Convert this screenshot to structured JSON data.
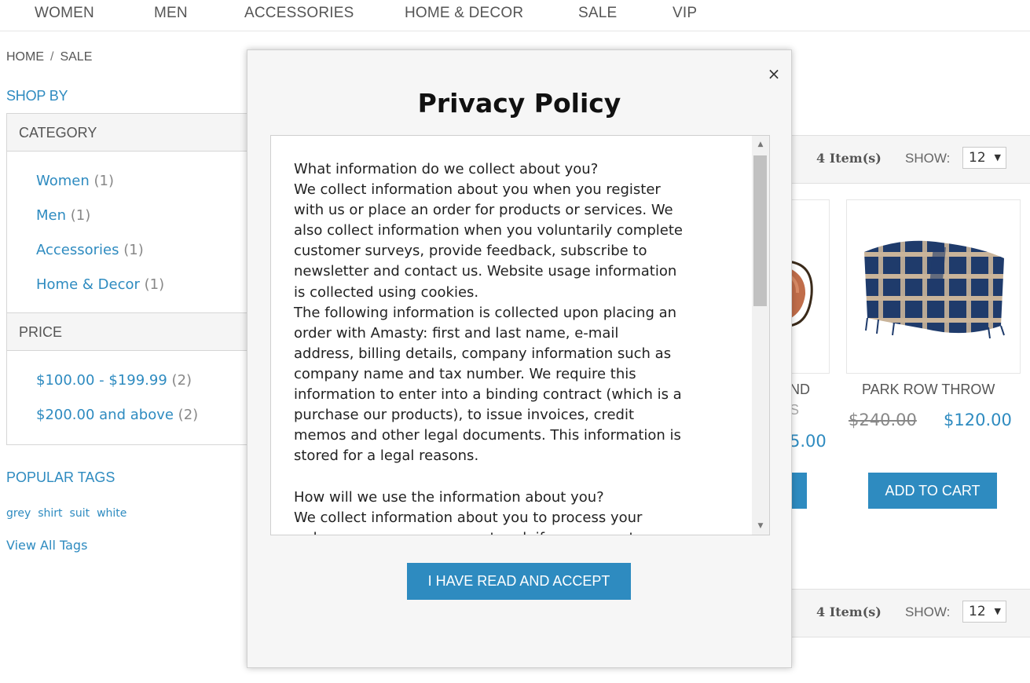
{
  "nav": [
    "WOMEN",
    "MEN",
    "ACCESSORIES",
    "HOME & DECOR",
    "SALE",
    "VIP"
  ],
  "breadcrumb": [
    "HOME",
    "SALE"
  ],
  "breadcrumb_sep": "/",
  "sidebar": {
    "shop_by": "SHOP BY",
    "category": {
      "title": "CATEGORY",
      "items": [
        {
          "label": "Women",
          "count": "(1)"
        },
        {
          "label": "Men",
          "count": "(1)"
        },
        {
          "label": "Accessories",
          "count": "(1)"
        },
        {
          "label": "Home & Decor",
          "count": "(1)"
        }
      ]
    },
    "price": {
      "title": "PRICE",
      "items": [
        {
          "label": "$100.00 - $199.99",
          "count": "(2)"
        },
        {
          "label": "$200.00 and above",
          "count": "(2)"
        }
      ]
    },
    "popular_tags": "POPULAR TAGS",
    "tags": [
      "grey",
      "shirt",
      "suit",
      "white"
    ],
    "view_all": "View All Tags"
  },
  "toolbar": {
    "count": "4 Item(s)",
    "show_label": "SHOW:",
    "show_value": "12",
    "arrow": "▼"
  },
  "products": [
    {
      "name_fragment": "ND",
      "name_fragment2": "S",
      "price_fragment": "5.00",
      "cart": ""
    },
    {
      "name": "PARK ROW THROW",
      "old_price": "$240.00",
      "new_price": "$120.00",
      "cart": "ADD TO CART"
    }
  ],
  "modal": {
    "close": "×",
    "title": "Privacy Policy",
    "body": "What information do we collect about you?\nWe collect information about you when you register\nwith us or place an order for products or services. We\nalso collect information when you voluntarily complete\ncustomer surveys, provide feedback, subscribe to\nnewsletter and contact us. Website usage information\nis collected using cookies.\nThe following information is collected upon placing an\norder with Amasty: first and last name, e-mail\naddress, billing details, company information such as\ncompany name and tax number. We require this\ninformation to enter into a binding contract (which is a\npurchase our products), to issue invoices, credit\nmemos and other legal documents. This information is\nstored for a legal reasons.\n\nHow will we use the information about you?\nWe collect information about you to process your\norder, manage your account and, if you agree, to",
    "scroll_up": "▲",
    "scroll_down": "▼",
    "accept": "I HAVE READ AND ACCEPT"
  },
  "colors": {
    "accent": "#2e8bc0",
    "panel_bg": "#f5f5f5"
  }
}
